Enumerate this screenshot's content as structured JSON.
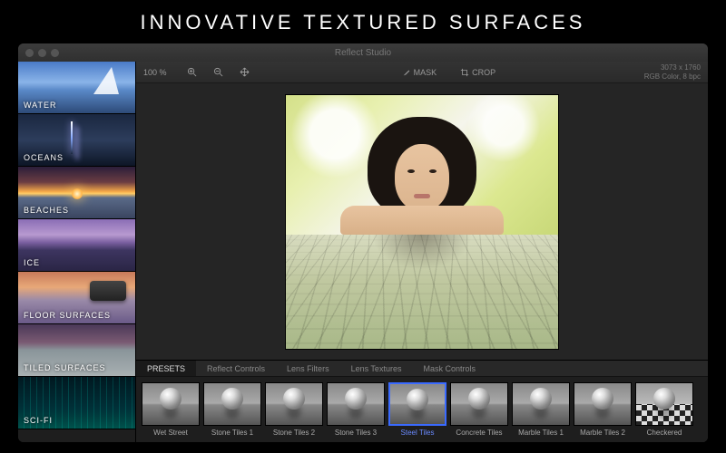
{
  "tagline": "INNOVATIVE TEXTURED SURFACES",
  "window": {
    "title": "Reflect Studio"
  },
  "toolbar": {
    "zoom": "100 %",
    "mask": "MASK",
    "crop": "CROP",
    "info_dims": "3073 x 1760",
    "info_mode": "RGB Color, 8 bpc"
  },
  "sidebar": {
    "categories": [
      {
        "label": "WATER"
      },
      {
        "label": "OCEANS"
      },
      {
        "label": "BEACHES"
      },
      {
        "label": "ICE"
      },
      {
        "label": "FLOOR SURFACES"
      },
      {
        "label": "TILED SURFACES"
      },
      {
        "label": "SCI-FI"
      }
    ]
  },
  "tabs": [
    {
      "label": "PRESETS",
      "active": true
    },
    {
      "label": "Reflect Controls"
    },
    {
      "label": "Lens Filters"
    },
    {
      "label": "Lens Textures"
    },
    {
      "label": "Mask Controls"
    }
  ],
  "presets": [
    {
      "label": "Wet Street"
    },
    {
      "label": "Stone Tiles 1"
    },
    {
      "label": "Stone Tiles 2"
    },
    {
      "label": "Stone Tiles 3"
    },
    {
      "label": "Steel Tiles",
      "selected": true
    },
    {
      "label": "Concrete Tiles"
    },
    {
      "label": "Marble Tiles 1"
    },
    {
      "label": "Marble Tiles 2"
    },
    {
      "label": "Checkered",
      "checker": true
    }
  ]
}
